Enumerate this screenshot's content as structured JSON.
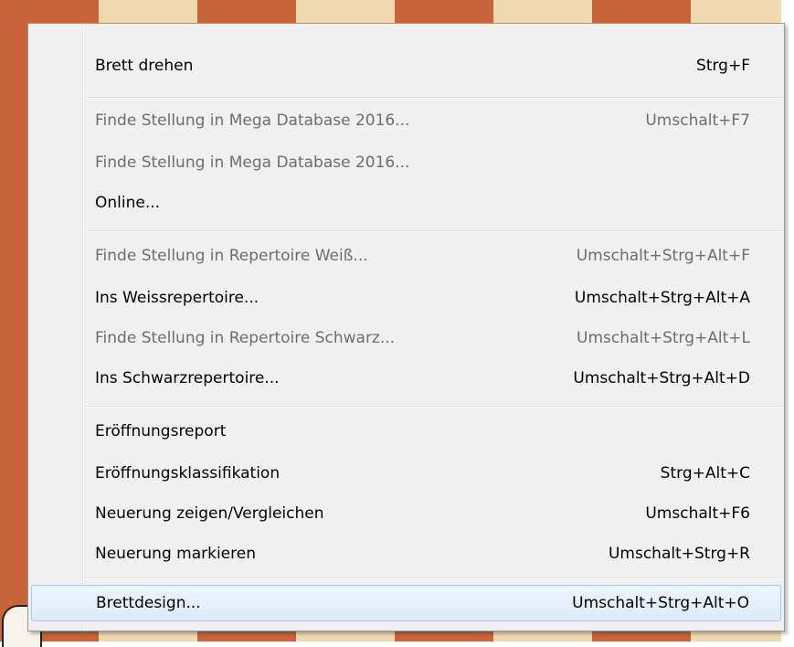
{
  "menu": {
    "items": [
      {
        "label": "Brett drehen",
        "shortcut": "Strg+F",
        "enabled": true
      },
      {
        "label": "Finde Stellung in Mega Database 2016...",
        "shortcut": "Umschalt+F7",
        "enabled": false
      },
      {
        "label": "Finde Stellung in Mega Database 2016...",
        "shortcut": "",
        "enabled": false
      },
      {
        "label": "Online...",
        "shortcut": "",
        "enabled": true
      },
      {
        "label": "Finde Stellung in Repertoire Weiß...",
        "shortcut": "Umschalt+Strg+Alt+F",
        "enabled": false
      },
      {
        "label": "Ins Weissrepertoire...",
        "shortcut": "Umschalt+Strg+Alt+A",
        "enabled": true
      },
      {
        "label": "Finde Stellung in Repertoire Schwarz...",
        "shortcut": "Umschalt+Strg+Alt+L",
        "enabled": false
      },
      {
        "label": "Ins Schwarzrepertoire...",
        "shortcut": "Umschalt+Strg+Alt+D",
        "enabled": true
      },
      {
        "label": "Eröffnungsreport",
        "shortcut": "",
        "enabled": true
      },
      {
        "label": "Eröffnungsklassifikation",
        "shortcut": "Strg+Alt+C",
        "enabled": true
      },
      {
        "label": "Neuerung zeigen/Vergleichen",
        "shortcut": "Umschalt+F6",
        "enabled": true
      },
      {
        "label": "Neuerung markieren",
        "shortcut": "Umschalt+Strg+R",
        "enabled": true
      },
      {
        "label": "Brettdesign...",
        "shortcut": "Umschalt+Strg+Alt+O",
        "enabled": true,
        "hovered": true
      }
    ]
  }
}
